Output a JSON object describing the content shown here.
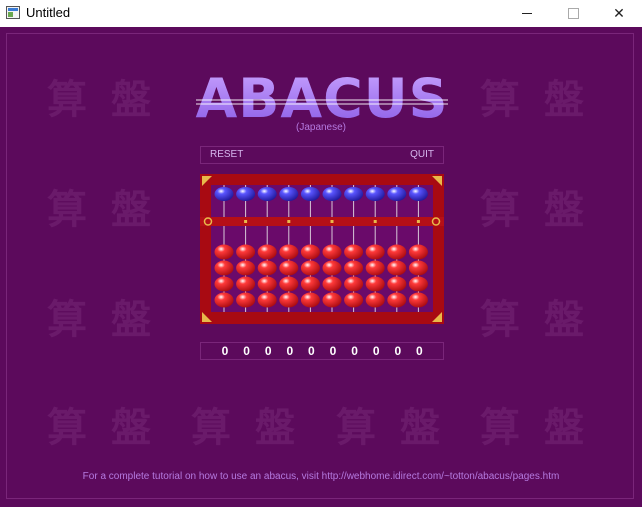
{
  "window": {
    "title": "Untitled",
    "close_glyph": "✕"
  },
  "watermark": {
    "text": "算盤"
  },
  "logo": {
    "title": "ABACUS",
    "subtitle": "(Japanese)"
  },
  "controls": {
    "reset_label": "RESET",
    "quit_label": "QUIT"
  },
  "abacus": {
    "rods": 10,
    "heaven_beads_per_rod": 1,
    "earth_beads_per_rod": 4,
    "colors": {
      "frame": "#a80a12",
      "heaven_bead": "#2a22c8",
      "earth_bead": "#e0101a",
      "beam": "#b50f17",
      "corner_ornament": "#e8b94a"
    }
  },
  "readout": {
    "digits": [
      "0",
      "0",
      "0",
      "0",
      "0",
      "0",
      "0",
      "0",
      "0",
      "0"
    ]
  },
  "footer": {
    "text": "For a complete tutorial on how to use an abacus, visit http://webhome.idirect.com/~totton/abacus/pages.htm"
  },
  "colors": {
    "background": "#5c0a5c",
    "text_accent": "#b57ae0"
  }
}
